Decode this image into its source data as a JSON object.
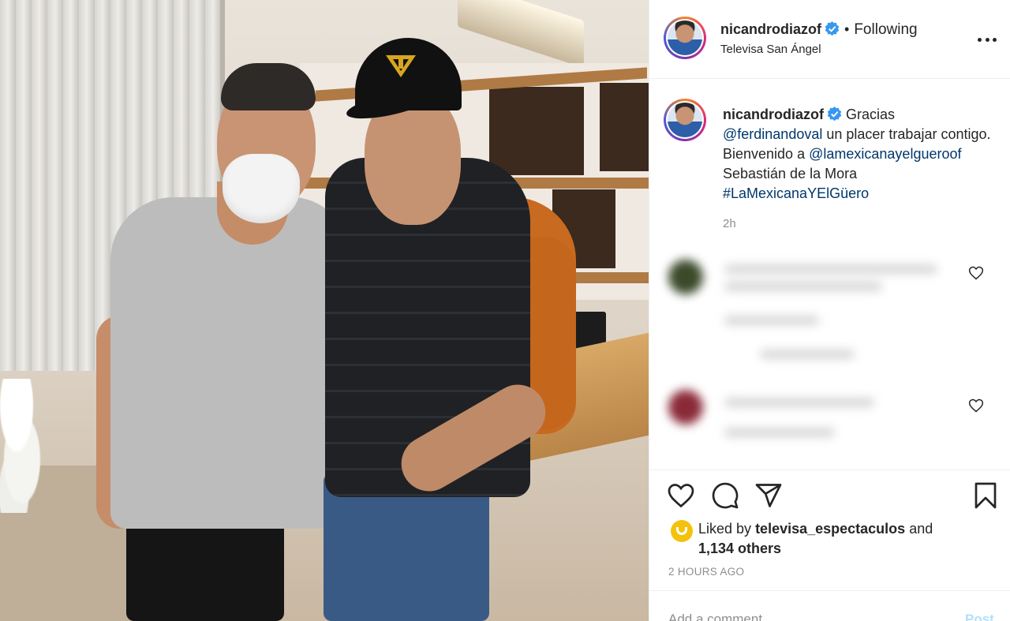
{
  "post": {
    "username": "nicandrodiazof",
    "location": "Televisa San Ángel",
    "follow_status": "Following",
    "separator": "•"
  },
  "caption": {
    "username": "nicandrodiazof",
    "text_1": "Gracias",
    "mention_1": "@ferdinandoval",
    "text_2": "un placer trabajar contigo. Bienvenido a",
    "mention_2": "@lamexicanayelgueroof",
    "text_3": "Sebastián de la Mora",
    "hashtag": "#LaMexicanaYElGüero",
    "time": "2h"
  },
  "likes": {
    "prefix": "Liked by",
    "username": "televisa_espectaculos",
    "conjunction": "and",
    "others": "1,134 others"
  },
  "timestamp": "2 HOURS AGO",
  "comment_box": {
    "placeholder": "Add a comment…",
    "post_label": "Post"
  },
  "colors": {
    "link": "#00376b",
    "verified": "#3897f0",
    "muted": "#8e8e8e"
  },
  "icons": {
    "like": "heart-icon",
    "comment": "comment-icon",
    "share": "paper-plane-icon",
    "save": "bookmark-icon",
    "more": "more-options-icon"
  }
}
